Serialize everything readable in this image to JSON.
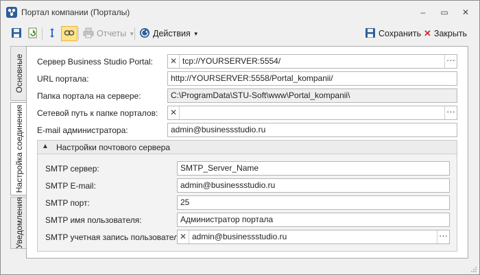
{
  "window": {
    "title": "Портал компании (Порталы)",
    "controls": {
      "minimize": "‒",
      "restore": "▭",
      "close": "✕"
    }
  },
  "toolbar": {
    "save_icon": "floppy-disk-icon",
    "refresh_icon": "refresh-icon",
    "expand_icon": "expand-icon",
    "link_icon": "link-icon",
    "reports_label": "Отчеты",
    "actions_label": "Действия",
    "save_label": "Сохранить",
    "close_label": "Закрыть"
  },
  "tabs": [
    {
      "label": "Основные",
      "active": false
    },
    {
      "label": "Настройка соединения",
      "active": true
    },
    {
      "label": "Уведомления",
      "active": false
    }
  ],
  "form": {
    "server_label": "Сервер Business Studio Portal:",
    "server_value": "tcp://YOURSERVER:5554/",
    "url_label": "URL портала:",
    "url_value": "http://YOURSERVER:5558/Portal_kompanii/",
    "folder_label": "Папка портала на сервере:",
    "folder_value": "C:\\ProgramData\\STU-Soft\\www\\Portal_kompanii\\",
    "netpath_label": "Сетевой путь к папке порталов:",
    "netpath_value": "",
    "email_label": "E-mail администратора:",
    "email_value": "admin@businessstudio.ru"
  },
  "mail": {
    "title": "Настройки почтового сервера",
    "smtp_server_label": "SMTP сервер:",
    "smtp_server_value": "SMTP_Server_Name",
    "smtp_email_label": "SMTP E-mail:",
    "smtp_email_value": "admin@businessstudio.ru",
    "smtp_port_label": "SMTP порт:",
    "smtp_port_value": "25",
    "smtp_user_label": "SMTP имя пользователя:",
    "smtp_user_value": "Администратор портала",
    "smtp_account_label": "SMTP учетная запись пользователя:",
    "smtp_account_value": "admin@businessstudio.ru"
  },
  "colors": {
    "accent_blue": "#2c5f99",
    "active_toggle": "#ffe38a",
    "close_red": "#d12b2b"
  }
}
